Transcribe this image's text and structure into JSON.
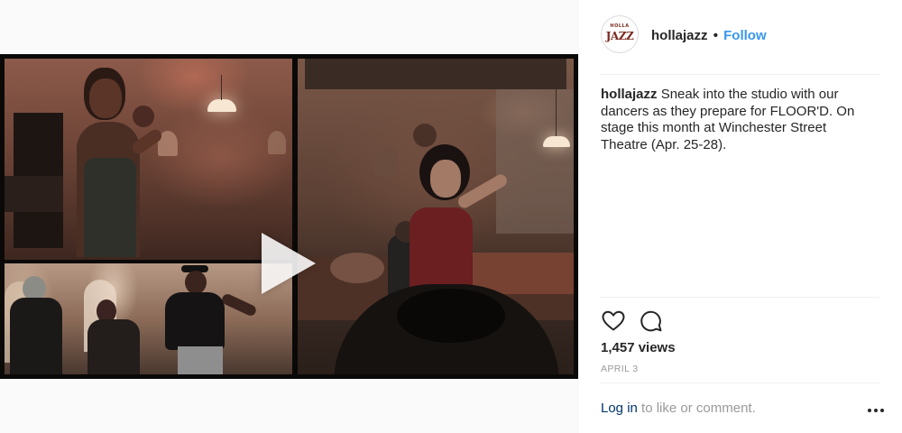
{
  "post": {
    "username": "hollajazz",
    "separator": "•",
    "follow_label": "Follow",
    "avatar": {
      "line1": "HOLLA",
      "line2": "JAZZ"
    },
    "caption": {
      "username": "hollajazz",
      "text": "Sneak into the studio with our dancers as they prepare for FLOOR'D. On stage this month at Winchester Street Theatre (Apr. 25-28)."
    },
    "views": "1,457 views",
    "date": "APRIL 3",
    "comment_prompt": {
      "login_label": "Log in",
      "rest": "to like or comment."
    }
  },
  "icons": {
    "like": "heart-icon",
    "comment": "comment-bubble-icon",
    "more": "more-options-icon",
    "play": "play-icon"
  },
  "colors": {
    "follow": "#3897f0",
    "login": "#003569",
    "muted": "#999999",
    "text": "#262626"
  }
}
